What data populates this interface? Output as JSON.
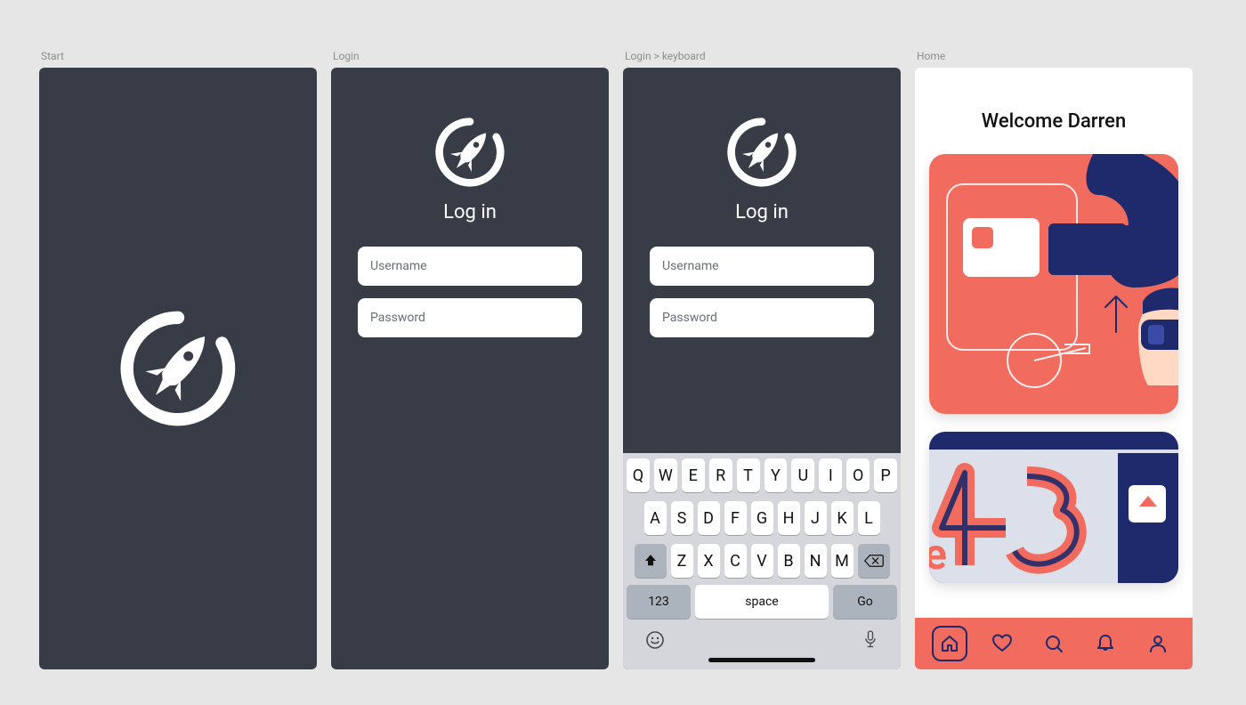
{
  "colors": {
    "canvas": "#e6e6e6",
    "dark": "#373c47",
    "coral": "#f16b5e",
    "navy": "#1e2a6b"
  },
  "screens": {
    "start": {
      "label": "Start"
    },
    "login": {
      "label": "Login",
      "title": "Log in",
      "username_placeholder": "Username",
      "password_placeholder": "Password"
    },
    "login_keyboard": {
      "label": "Login > keyboard",
      "title": "Log in",
      "username_placeholder": "Username",
      "password_placeholder": "Password",
      "keyboard": {
        "row1": [
          "Q",
          "W",
          "E",
          "R",
          "T",
          "Y",
          "U",
          "I",
          "O",
          "P"
        ],
        "row2": [
          "A",
          "S",
          "D",
          "F",
          "G",
          "H",
          "J",
          "K",
          "L"
        ],
        "row3": [
          "Z",
          "X",
          "C",
          "V",
          "B",
          "N",
          "M"
        ],
        "numbers_label": "123",
        "space_label": "space",
        "go_label": "Go"
      }
    },
    "home": {
      "label": "Home",
      "welcome": "Welcome Darren",
      "tabs": [
        {
          "name": "home",
          "icon": "home-icon",
          "active": true
        },
        {
          "name": "favorites",
          "icon": "heart-icon",
          "active": false
        },
        {
          "name": "search",
          "icon": "search-icon",
          "active": false
        },
        {
          "name": "alerts",
          "icon": "bell-icon",
          "active": false
        },
        {
          "name": "profile",
          "icon": "user-icon",
          "active": false
        }
      ]
    }
  }
}
